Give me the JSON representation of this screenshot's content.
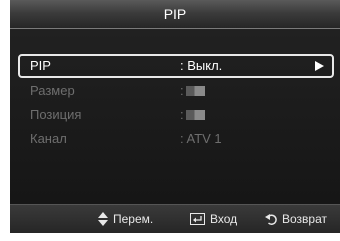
{
  "header": {
    "title": "PIP"
  },
  "menu": {
    "items": [
      {
        "label": "PIP",
        "value": ": Выкл."
      },
      {
        "label": "Размер",
        "value": ":"
      },
      {
        "label": "Позиция",
        "value": ":"
      },
      {
        "label": "Канал",
        "value": ": ATV 1"
      }
    ]
  },
  "hints": {
    "move_label": "Перем.",
    "enter_label": "Вход",
    "return_label": "Возврат",
    "move_icon": "up-down-arrow-icon",
    "enter_icon": "enter-icon",
    "return_icon": "return-icon"
  },
  "colors": {
    "background": "#1a1a1a",
    "active_text": "#ffffff",
    "inactive_text": "#6e6e6e",
    "highlight_border": "#e8e8e8"
  }
}
